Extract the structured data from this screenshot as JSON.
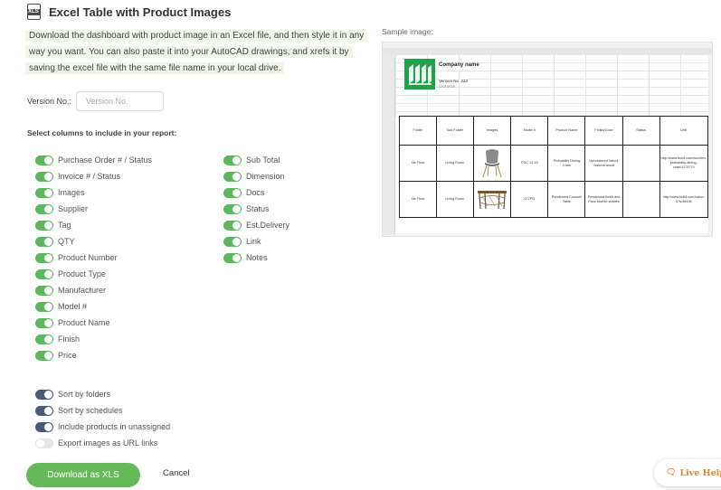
{
  "header": {
    "icon_text": "XLS",
    "title": "Excel Table with Product Images"
  },
  "description": "Download the dashboard with product image in an Excel file, and then style it in any way you want. You can also paste it into your AutoCAD drawings, and xrefs it by saving the excel file with the same file name in your local drive.",
  "version": {
    "label": "Version No.:",
    "placeholder": "Version No.",
    "value": ""
  },
  "columns_title": "Select columns to include in your report:",
  "columns_left": [
    {
      "label": "Purchase Order # / Status",
      "on": true
    },
    {
      "label": "Invoice # / Status",
      "on": true
    },
    {
      "label": "Images",
      "on": true
    },
    {
      "label": "Supplier",
      "on": true
    },
    {
      "label": "Tag",
      "on": true
    },
    {
      "label": "QTY",
      "on": true
    },
    {
      "label": "Product Number",
      "on": true
    },
    {
      "label": "Product Type",
      "on": true
    },
    {
      "label": "Manufacturer",
      "on": true
    },
    {
      "label": "Model #",
      "on": true
    },
    {
      "label": "Product Name",
      "on": true
    },
    {
      "label": "Finish",
      "on": true
    },
    {
      "label": "Price",
      "on": true
    }
  ],
  "columns_right": [
    {
      "label": "Sub Total",
      "on": true
    },
    {
      "label": "Dimension",
      "on": true
    },
    {
      "label": "Docs",
      "on": true
    },
    {
      "label": "Status",
      "on": true
    },
    {
      "label": "Est.Delivery",
      "on": true
    },
    {
      "label": "Link",
      "on": true
    },
    {
      "label": "Notes",
      "on": true
    }
  ],
  "options": [
    {
      "label": "Sort by folders",
      "on": true
    },
    {
      "label": "Sort by schedules",
      "on": true
    },
    {
      "label": "Include products in unassigned",
      "on": true
    },
    {
      "label": "Export images as URL links",
      "on": false
    }
  ],
  "buttons": {
    "download": "Download as XLS",
    "cancel": "Cancel"
  },
  "sample": {
    "label": "Sample image:",
    "company": "Company name",
    "version": "Version No. 223",
    "date": "12/21/2018",
    "headers": [
      "Folder",
      "Sub Folder",
      "Images",
      "Model #",
      "Product Name",
      "Finish/Color",
      "Status",
      "Link"
    ],
    "rows": [
      [
        "1st Floor",
        "Living Room",
        "",
        "PDC 12 15",
        "Probability Dining Chair",
        "Upholstered Velour Natural wood",
        "",
        "http://www.build.com/wooden-probability-dining-chair/1173779"
      ],
      [
        "1st Floor",
        "Living Room",
        "",
        "077PD",
        "Ponderosa Console Table",
        "Ponderosa finish and Faux Marble shades",
        "",
        "http://www.build.com/catco-57tc35436"
      ]
    ]
  },
  "live_help": "Live Help",
  "colors": {
    "green": "#66b95a",
    "toggle_blue": "#4a5a78",
    "live_help": "#e8852c"
  }
}
